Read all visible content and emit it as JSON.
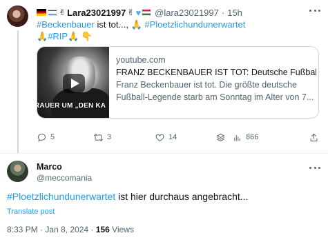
{
  "tweet1": {
    "display_name": "Lara23021997",
    "handle": "@lara23021997",
    "time": "15h",
    "text_hashtag1": "#Beckenbauer",
    "text_mid": " ist tot..., ",
    "text_hashtag2": "#Ploetzlichundunerwartet",
    "text_hashtag3": "#RIP",
    "emoji_hands": "🙏",
    "emoji_point": "👇",
    "emoji_peace": "✌",
    "card": {
      "domain": "youtube.com",
      "title": "FRANZ BECKENBAUER IST TOT: Deutsche Fußball-Legende",
      "description_line1": "Franz Beckenbauer ist tot. Die größte deutsche",
      "description_line2": "Fußball-Legende starb am Sonntag im Alter von 7...",
      "thumbnail_caption": "RAUER UM „DEN KA"
    },
    "actions": {
      "replies": "5",
      "retweets": "3",
      "likes": "14",
      "views": "866"
    }
  },
  "tweet2": {
    "display_name": "Marco",
    "handle": "@meccomania",
    "text_hashtag": "#Ploetzlichundunerwartet",
    "text_rest": " ist hier durchaus angebracht...",
    "translate_label": "Translate post",
    "time": "8:33 PM",
    "date": "Jan 8, 2024",
    "views_count": "156",
    "views_label": "Views"
  },
  "colors": {
    "link_blue": "#1d9bf0",
    "secondary_text": "#536471",
    "primary_text": "#0f1419"
  }
}
